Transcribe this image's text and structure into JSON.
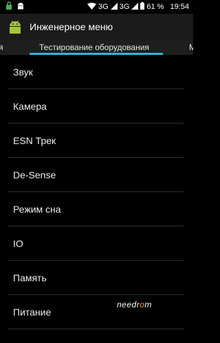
{
  "status_bar": {
    "network_left": "3G",
    "network_right": "3G",
    "battery_percent": "61 %",
    "time": "19:54"
  },
  "action_bar": {
    "title": "Инженерное меню"
  },
  "tabs": {
    "prev_label": "я",
    "active_label": "Тестирование оборудования",
    "next_label": "М"
  },
  "list": {
    "items": [
      {
        "label": "Звук"
      },
      {
        "label": "Камера"
      },
      {
        "label": "ESN Трек"
      },
      {
        "label": "De-Sense"
      },
      {
        "label": "Режим сна"
      },
      {
        "label": "IO"
      },
      {
        "label": "Память"
      },
      {
        "label": "Питание"
      }
    ]
  },
  "watermark": {
    "text_a": "needr",
    "text_b": "o",
    "text_c": "m"
  },
  "colors": {
    "accent": "#33b5e5",
    "android_green": "#a4c639",
    "background": "#000000"
  }
}
